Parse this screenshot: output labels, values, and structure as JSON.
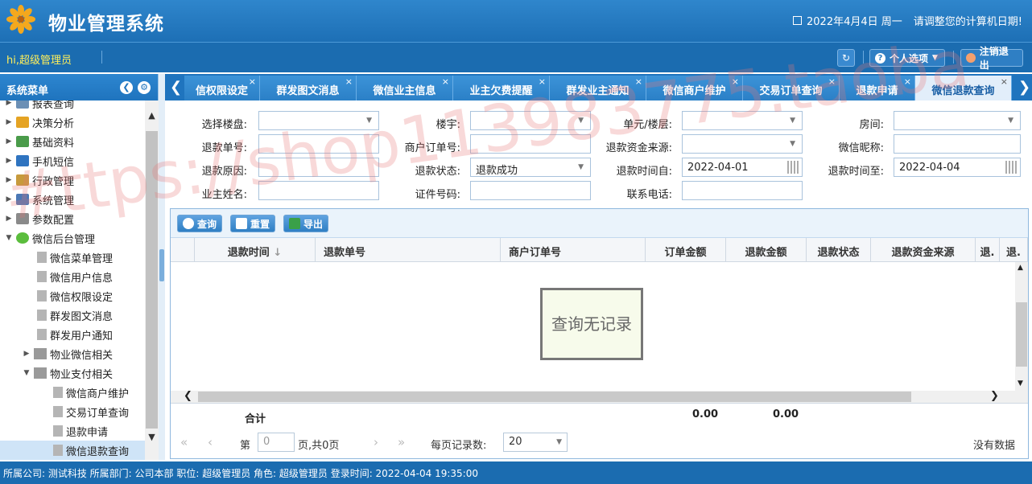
{
  "app": {
    "title": "物业管理系统",
    "date": "2022年4月4日 周一",
    "date_hint": "请调整您的计算机日期!"
  },
  "toolbar": {
    "greeting": "hi,超级管理员",
    "personal_label": "个人选项",
    "logout_label": "注销退出"
  },
  "sidebar": {
    "title": "系统菜单",
    "items": [
      {
        "label": "报表查询",
        "level": 0
      },
      {
        "label": "决策分析",
        "level": 0
      },
      {
        "label": "基础资料",
        "level": 0
      },
      {
        "label": "手机短信",
        "level": 0
      },
      {
        "label": "行政管理",
        "level": 0
      },
      {
        "label": "系统管理",
        "level": 0
      },
      {
        "label": "参数配置",
        "level": 0
      },
      {
        "label": "微信后台管理",
        "level": 0
      },
      {
        "label": "微信菜单管理",
        "level": 1
      },
      {
        "label": "微信用户信息",
        "level": 1
      },
      {
        "label": "微信权限设定",
        "level": 1
      },
      {
        "label": "群发图文消息",
        "level": 1
      },
      {
        "label": "群发用户通知",
        "level": 1
      },
      {
        "label": "物业微信相关",
        "level": 1
      },
      {
        "label": "物业支付相关",
        "level": 1
      },
      {
        "label": "微信商户维护",
        "level": 2
      },
      {
        "label": "交易订单查询",
        "level": 2
      },
      {
        "label": "退款申请",
        "level": 2
      },
      {
        "label": "微信退款查询",
        "level": 2
      }
    ]
  },
  "tabs": [
    {
      "label": "信权限设定"
    },
    {
      "label": "群发图文消息"
    },
    {
      "label": "微信业主信息"
    },
    {
      "label": "业主欠费提醒"
    },
    {
      "label": "群发业主通知"
    },
    {
      "label": "微信商户维护"
    },
    {
      "label": "交易订单查询"
    },
    {
      "label": "退款申请"
    },
    {
      "label": "微信退款查询"
    }
  ],
  "form": {
    "building": "选择楼盘:",
    "house": "楼宇:",
    "unit": "单元/楼层:",
    "room": "房间:",
    "refund_no": "退款单号:",
    "merchant_order": "商户订单号:",
    "fund_source": "退款资金来源:",
    "wx_nick": "微信昵称:",
    "reason": "退款原因:",
    "status": "退款状态:",
    "status_value": "退款成功",
    "time_from": "退款时间自:",
    "time_from_value": "2022-04-01",
    "time_to": "退款时间至:",
    "time_to_value": "2022-04-04",
    "owner": "业主姓名:",
    "id_no": "证件号码:",
    "phone": "联系电话:"
  },
  "grid": {
    "btn_query": "查询",
    "btn_reset": "重置",
    "btn_export": "导出",
    "columns": [
      "退款时间",
      "退款单号",
      "商户订单号",
      "订单金额",
      "退款金额",
      "退款状态",
      "退款资金来源",
      "退.",
      "退."
    ],
    "empty": "查询无记录",
    "total_label": "合计",
    "order_total": "0.00",
    "refund_total": "0.00"
  },
  "pager": {
    "page_prefix": "第",
    "page_value": "0",
    "page_suffix": "页,共0页",
    "per_page_label": "每页记录数:",
    "per_page": "20",
    "no_data": "没有数据"
  },
  "status": {
    "text": "所属公司: 测试科技    所属部门: 公司本部    职位: 超级管理员    角色: 超级管理员    登录时间: 2022-04-04 19:35:00"
  },
  "watermark": "#ttps://shop113983775.taoba"
}
